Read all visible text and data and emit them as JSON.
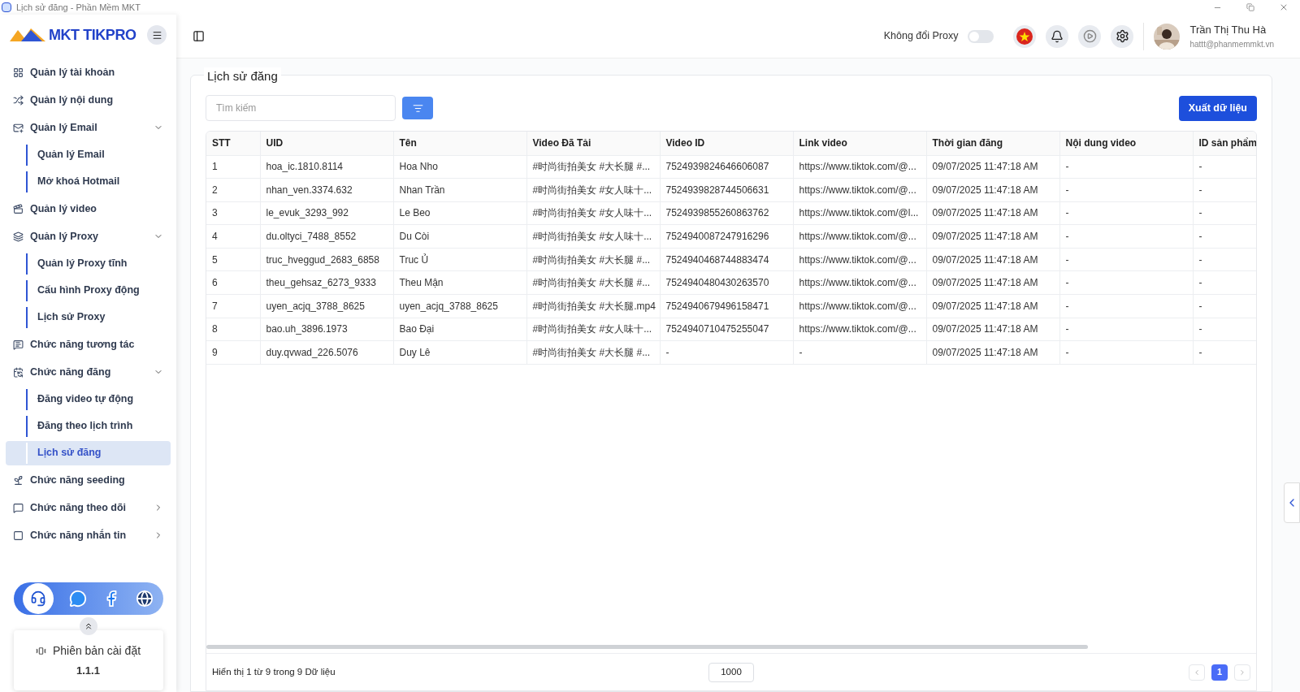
{
  "window": {
    "title": "Lịch sử đăng - Phần Mềm MKT"
  },
  "logo": {
    "text": "MKT TIKPRO"
  },
  "sidebar": {
    "items": [
      {
        "kind": "link",
        "label": "Quản lý tài khoản"
      },
      {
        "kind": "link",
        "label": "Quản lý nội dung"
      },
      {
        "kind": "group",
        "label": "Quản lý Email",
        "expanded": true,
        "children": [
          {
            "label": "Quản lý Email",
            "selected": false
          },
          {
            "label": "Mở khoá Hotmail",
            "selected": false
          }
        ]
      },
      {
        "kind": "link",
        "label": "Quản lý video"
      },
      {
        "kind": "group",
        "label": "Quản lý Proxy",
        "expanded": true,
        "children": [
          {
            "label": "Quản lý Proxy tĩnh",
            "selected": false
          },
          {
            "label": "Cấu hình Proxy động",
            "selected": false
          },
          {
            "label": "Lịch sử Proxy",
            "selected": false
          }
        ]
      },
      {
        "kind": "link",
        "label": "Chức năng tương tác"
      },
      {
        "kind": "group",
        "label": "Chức năng đăng",
        "expanded": true,
        "children": [
          {
            "label": "Đăng video tự động",
            "selected": false
          },
          {
            "label": "Đăng theo lịch trình",
            "selected": false
          },
          {
            "label": "Lịch sử đăng",
            "selected": true
          }
        ]
      },
      {
        "kind": "link",
        "label": "Chức năng seeding"
      },
      {
        "kind": "group",
        "label": "Chức năng theo dõi",
        "expanded": false
      },
      {
        "kind": "group",
        "label": "Chức năng nhắn tin",
        "expanded": false
      }
    ]
  },
  "version": {
    "label": "Phiên bản cài đặt",
    "value": "1.1.1"
  },
  "header": {
    "proxy_toggle": {
      "label": "Không đổi Proxy",
      "on": false
    },
    "user": {
      "name": "Trần Thị Thu Hà",
      "email": "hattt@phanmemmkt.vn"
    }
  },
  "page": {
    "title": "Lịch sử đăng",
    "search": {
      "placeholder": "Tìm kiếm"
    },
    "export_button": "Xuất dữ liệu"
  },
  "table": {
    "columns": [
      "STT",
      "UID",
      "Tên",
      "Video Đã Tải",
      "Video ID",
      "Link video",
      "Thời gian đăng",
      "Nội dung video",
      "ID sản phẩm"
    ],
    "rows": [
      [
        "1",
        "hoa_ic.1810.8114",
        "Hoa Nho",
        "#时尚街拍美女 #大长腿 #...",
        "7524939824646606087",
        "https://www.tiktok.com/@...",
        "09/07/2025 11:47:18 AM",
        "-",
        "-"
      ],
      [
        "2",
        "nhan_ven.3374.632",
        "Nhan Trần",
        "#时尚街拍美女 #女人味十...",
        "7524939828744506631",
        "https://www.tiktok.com/@...",
        "09/07/2025 11:47:18 AM",
        "-",
        "-"
      ],
      [
        "3",
        "le_evuk_3293_992",
        "Le Beo",
        "#时尚街拍美女 #女人味十...",
        "7524939855260863762",
        "https://www.tiktok.com/@l...",
        "09/07/2025 11:47:18 AM",
        "-",
        "-"
      ],
      [
        "4",
        "du.oltyci_7488_8552",
        "Du Còi",
        "#时尚街拍美女 #女人味十...",
        "7524940087247916296",
        "https://www.tiktok.com/@...",
        "09/07/2025 11:47:18 AM",
        "-",
        "-"
      ],
      [
        "5",
        "truc_hveggud_2683_6858",
        "Truc Ủ",
        "#时尚街拍美女 #大长腿 #...",
        "7524940468744883474",
        "https://www.tiktok.com/@...",
        "09/07/2025 11:47:18 AM",
        "-",
        "-"
      ],
      [
        "6",
        "theu_gehsaz_6273_9333",
        "Theu Mận",
        "#时尚街拍美女 #大长腿 #...",
        "7524940480430263570",
        "https://www.tiktok.com/@...",
        "09/07/2025 11:47:18 AM",
        "-",
        "-"
      ],
      [
        "7",
        "uyen_acjq_3788_8625",
        "uyen_acjq_3788_8625",
        "#时尚街拍美女 #大长腿.mp4",
        "7524940679496158471",
        "https://www.tiktok.com/@...",
        "09/07/2025 11:47:18 AM",
        "-",
        "-"
      ],
      [
        "8",
        "bao.uh_3896.1973",
        "Bao Đại",
        "#时尚街拍美女 #女人味十...",
        "7524940710475255047",
        "https://www.tiktok.com/@...",
        "09/07/2025 11:47:18 AM",
        "-",
        "-"
      ],
      [
        "9",
        "duy.qvwad_226.5076",
        "Duy Lê",
        "#时尚街拍美女 #大长腿 #...",
        "-",
        "-",
        "09/07/2025 11:47:18 AM",
        "-",
        "-"
      ]
    ]
  },
  "pagination": {
    "summary": "Hiển thị 1 từ 9 trong 9 Dữ liệu",
    "page_size": "1000",
    "pages": [
      {
        "label": "1",
        "selected": true
      }
    ]
  }
}
